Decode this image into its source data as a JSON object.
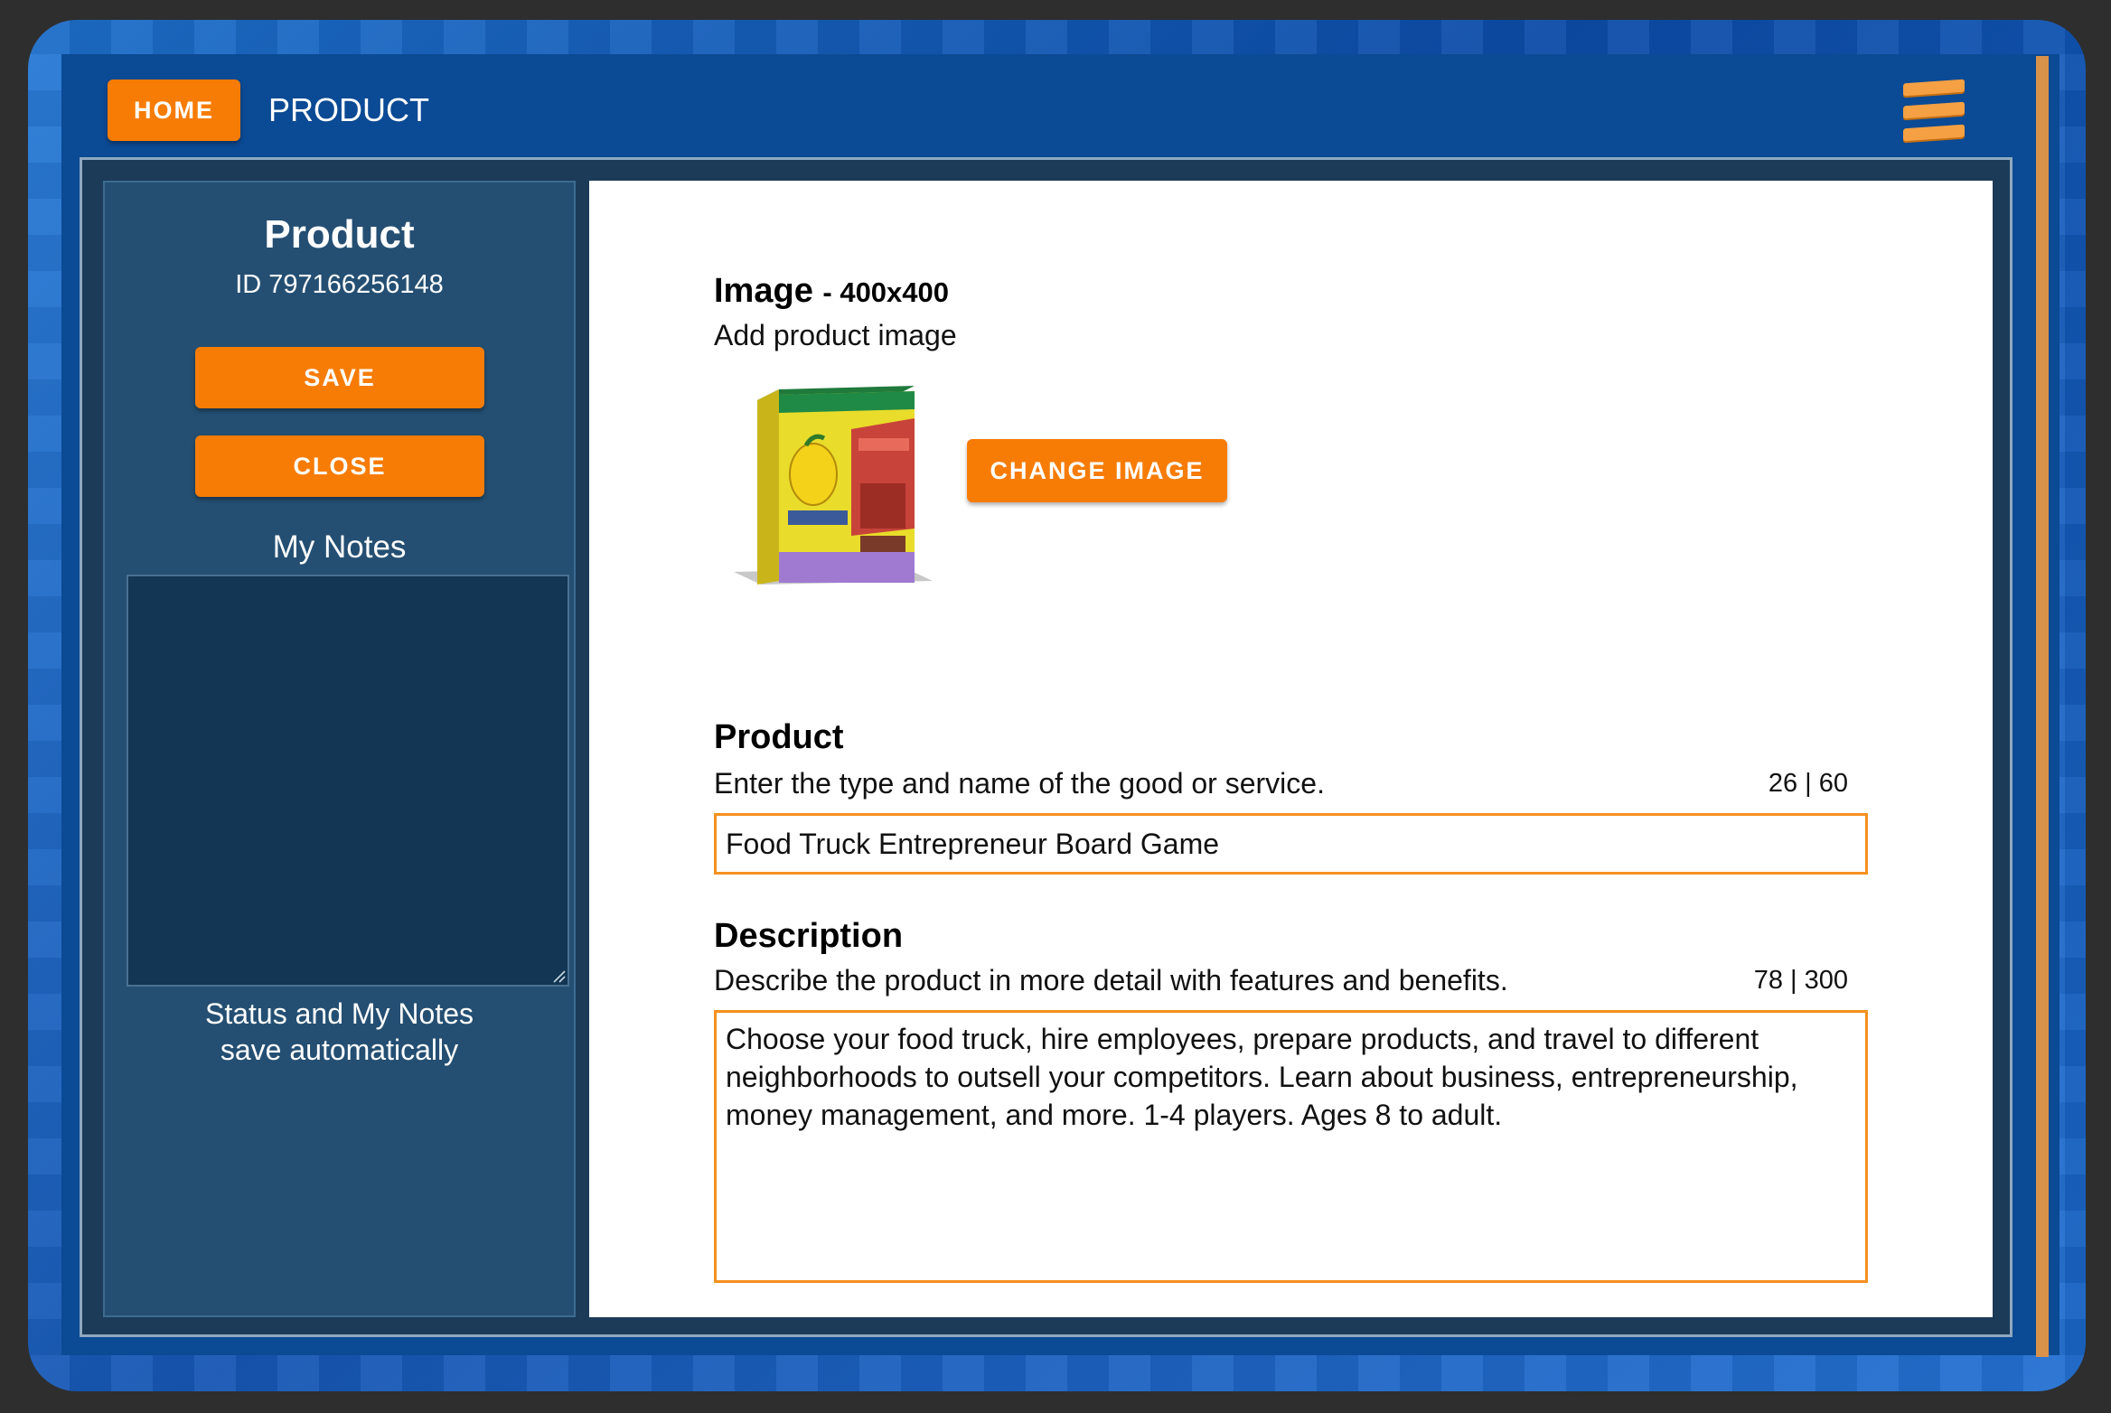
{
  "header": {
    "home_label": "HOME",
    "page_title": "PRODUCT"
  },
  "sidebar": {
    "title": "Product",
    "id_text": "ID 797166256148",
    "save_label": "SAVE",
    "close_label": "CLOSE",
    "notes_label": "My Notes",
    "notes_value": "",
    "status_line1": "Status and My Notes",
    "status_line2": "save automatically"
  },
  "image_section": {
    "title": "Image",
    "size_hint": "- 400x400",
    "description": "Add product image",
    "change_label": "CHANGE IMAGE"
  },
  "product_section": {
    "title": "Product",
    "description": "Enter the type and name of the good or service.",
    "counter": "26 | 60",
    "value": "Food Truck Entrepreneur Board Game"
  },
  "description_section": {
    "title": "Description",
    "description": "Describe the product in more detail with features and benefits.",
    "counter": "78 | 300",
    "value": "Choose your food truck, hire employees, prepare products, and travel to different neighborhoods to outsell your competitors. Learn about business, entrepreneurship, money management, and more. 1-4 players. Ages 8 to adult."
  },
  "colors": {
    "accent": "#f77c06",
    "input_border": "#f4901f",
    "panel": "#244f72",
    "header_bg": "#0b4a94"
  },
  "icons": {
    "menu": "hamburger-menu-icon",
    "resize": "resize-handle-icon"
  }
}
